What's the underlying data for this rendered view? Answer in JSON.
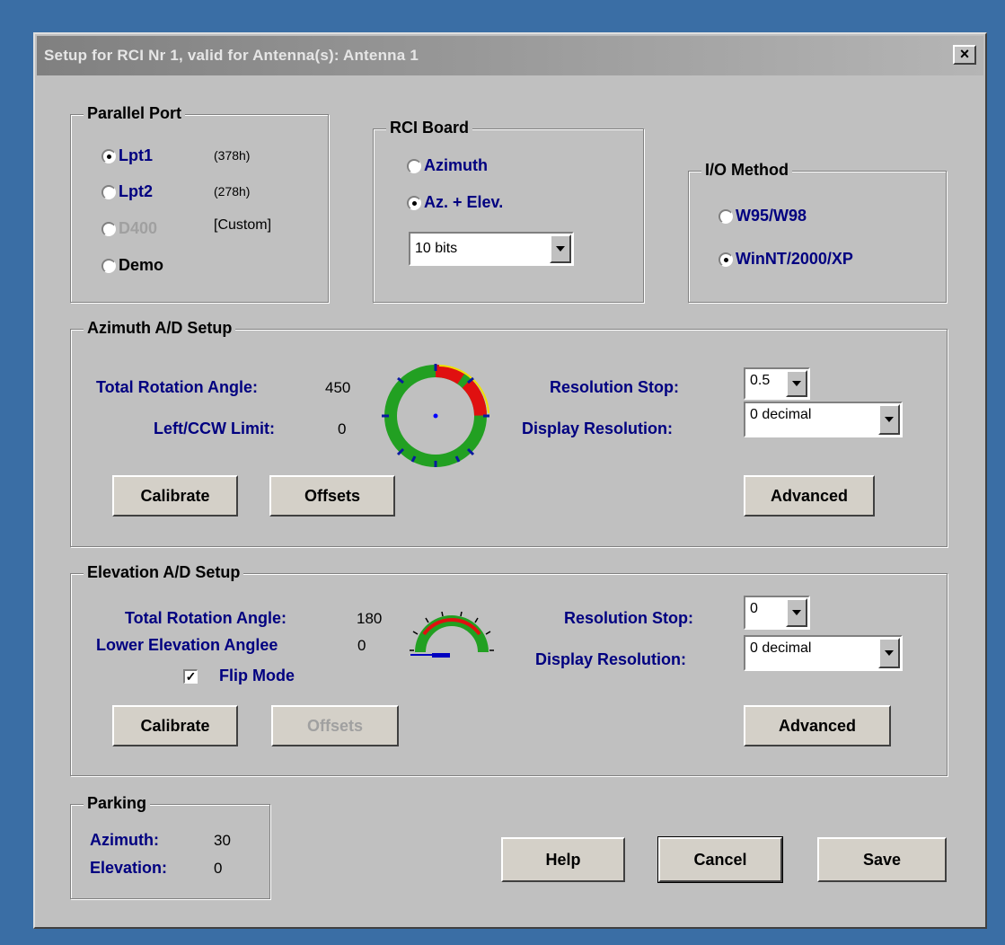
{
  "window": {
    "title": "Setup for RCI Nr 1,  valid for Antenna(s): Antenna 1",
    "close_label": "×"
  },
  "parallel_port": {
    "label": "Parallel Port",
    "options": [
      {
        "label": "Lpt1",
        "note": "(378h)",
        "selected": true,
        "enabled": true
      },
      {
        "label": "Lpt2",
        "note": "(278h)",
        "selected": false,
        "enabled": true
      },
      {
        "label": "D400",
        "note": "[Custom]",
        "selected": false,
        "enabled": false
      },
      {
        "label": "Demo",
        "note": "",
        "selected": false,
        "enabled": true
      }
    ]
  },
  "rci_board": {
    "label": "RCI Board",
    "options": [
      {
        "label": "Azimuth",
        "selected": false
      },
      {
        "label": "Az. + Elev.",
        "selected": true
      }
    ],
    "bits_value": "10 bits"
  },
  "io_method": {
    "label": "I/O Method",
    "options": [
      {
        "label": "W95/W98",
        "selected": false
      },
      {
        "label": "WinNT/2000/XP",
        "selected": true
      }
    ]
  },
  "azimuth_setup": {
    "label": "Azimuth A/D Setup",
    "total_rotation_label": "Total Rotation Angle:",
    "total_rotation_value": "450",
    "limit_label": "Left/CCW Limit:",
    "limit_value": "0",
    "resolution_stop_label": "Resolution Stop:",
    "resolution_stop_value": "0.5",
    "display_resolution_label": "Display Resolution:",
    "display_resolution_value": "0 decimal",
    "calibrate_label": "Calibrate",
    "offsets_label": "Offsets",
    "advanced_label": "Advanced"
  },
  "elevation_setup": {
    "label": "Elevation A/D Setup",
    "total_rotation_label": "Total Rotation Angle:",
    "total_rotation_value": "180",
    "lower_label": "Lower Elevation Anglee",
    "lower_value": "0",
    "flip_label": "Flip Mode",
    "flip_checked": true,
    "resolution_stop_label": "Resolution Stop:",
    "resolution_stop_value": "0",
    "display_resolution_label": "Display Resolution:",
    "display_resolution_value": "0 decimal",
    "calibrate_label": "Calibrate",
    "offsets_label": "Offsets",
    "advanced_label": "Advanced"
  },
  "parking": {
    "label": "Parking",
    "azimuth_label": "Azimuth:",
    "azimuth_value": "30",
    "elevation_label": "Elevation:",
    "elevation_value": "0"
  },
  "footer": {
    "help_label": "Help",
    "cancel_label": "Cancel",
    "save_label": "Save"
  },
  "colors": {
    "desktop": "#3a6ea5",
    "dialog": "#c0c0c0",
    "label_blue": "#000080",
    "gauge_green": "#22a022",
    "gauge_red": "#e01010",
    "gauge_yellow": "#f0e000"
  }
}
